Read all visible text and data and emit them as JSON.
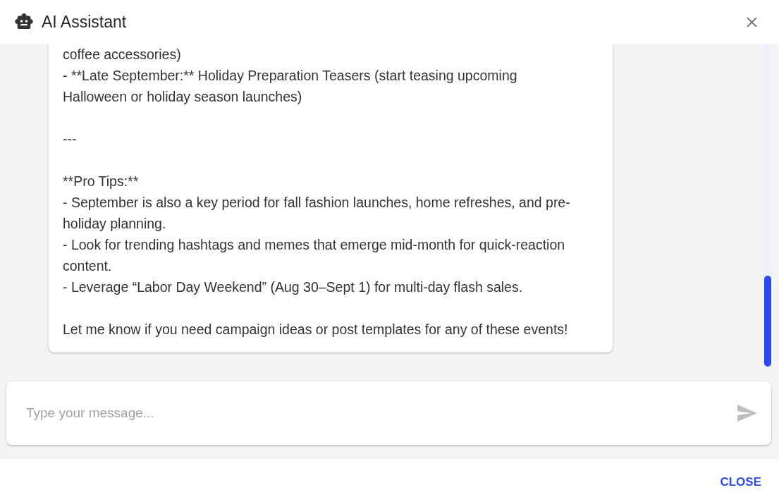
{
  "dialog": {
    "title": "AI Assistant"
  },
  "message": {
    "blocks": [
      {
        "lines": [
          "coffee accessories)",
          "- **Late September:** Holiday Preparation Teasers (start teasing upcoming Halloween or holiday season launches)"
        ]
      },
      {
        "lines": [
          "---"
        ]
      },
      {
        "lines": [
          "**Pro Tips:**",
          "- September is also a key period for fall fashion launches, home refreshes, and pre-holiday planning.",
          "- Look for trending hashtags and memes that emerge mid-month for quick-reaction content.",
          "- Leverage “Labor Day Weekend” (Aug 30–Sept 1) for multi-day flash sales."
        ]
      },
      {
        "lines": [
          "Let me know if you need campaign ideas or post templates for any of these events!"
        ]
      }
    ]
  },
  "composer": {
    "placeholder": "Type your message..."
  },
  "footer": {
    "buttons": [
      "CLOSE"
    ]
  }
}
